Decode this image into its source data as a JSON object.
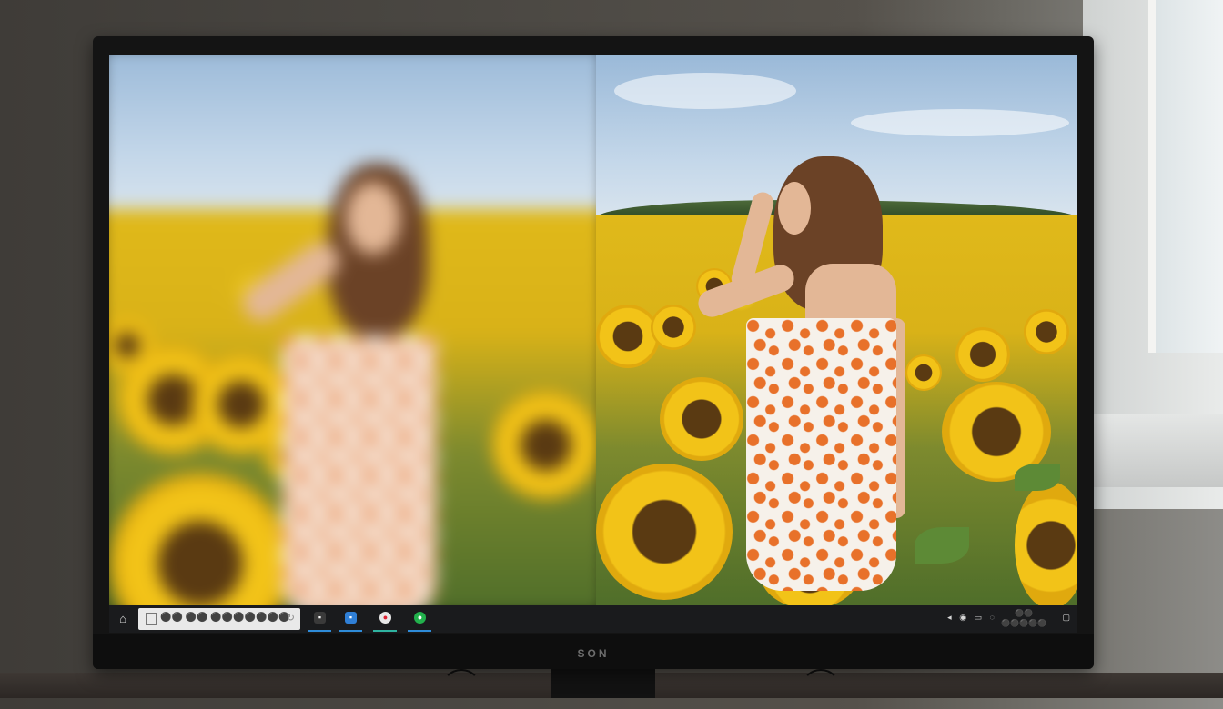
{
  "monitor": {
    "brand": "SON"
  },
  "screen": {
    "left_image": {
      "description_icon": "blurred-photo"
    },
    "right_image": {
      "description_icon": "sharp-photo"
    }
  },
  "taskbar": {
    "start_icon": "home-icon",
    "search": {
      "text": "⚫⚫ ⚫⚫ ⚫⚫⚫⚫⚫⚫⚫",
      "button_icon": "refresh-icon"
    },
    "apps": [
      {
        "icon": "file-explorer-icon",
        "color": "#3a3a3a"
      },
      {
        "icon": "app-blue-icon",
        "color": "#2f7fd6"
      },
      {
        "icon": "app-red-icon",
        "color": "#e8e8e8"
      },
      {
        "icon": "app-green-icon",
        "color": "#22b14c"
      }
    ],
    "tray": {
      "icons": [
        "network-icon",
        "volume-icon",
        "battery-icon",
        "wifi-icon",
        "notification-icon"
      ]
    },
    "clock": {
      "line1": "⚫⚫",
      "line2": "⚫⚫⚫⚫⚫"
    }
  }
}
